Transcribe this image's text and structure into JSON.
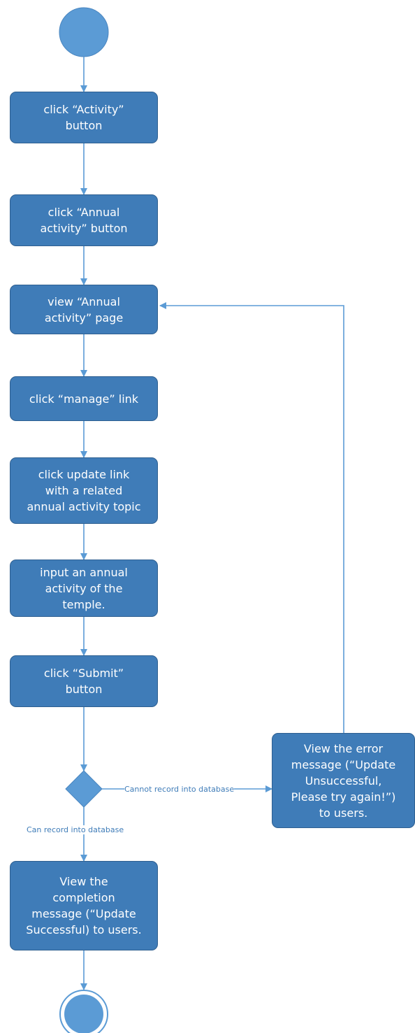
{
  "nodes": {
    "click_activity": "click “Activity”\nbutton",
    "click_annual_activity": "click “Annual\nactivity” button",
    "view_annual_activity_page": "view “Annual\nactivity” page",
    "click_manage_link": "click “manage” link",
    "click_update_link": "click update link\nwith a related\nannual activity topic",
    "input_annual_activity": "input an annual\nactivity of the\ntemple.",
    "click_submit": "click “Submit”\nbutton",
    "view_error_message": "View the error\nmessage (“Update\nUnsuccessful,\nPlease try again!”)\nto users.",
    "view_completion_message": "View the\ncompletion\nmessage (“Update\nSuccessful) to users."
  },
  "edge_labels": {
    "cannot_record": "Cannot record into database",
    "can_record": "Can record into database"
  },
  "colors": {
    "node_fill": "#3f7cb8",
    "node_border": "#2e5f90",
    "start_end_fill": "#5b9bd5",
    "connector": "#5b9bd5"
  }
}
